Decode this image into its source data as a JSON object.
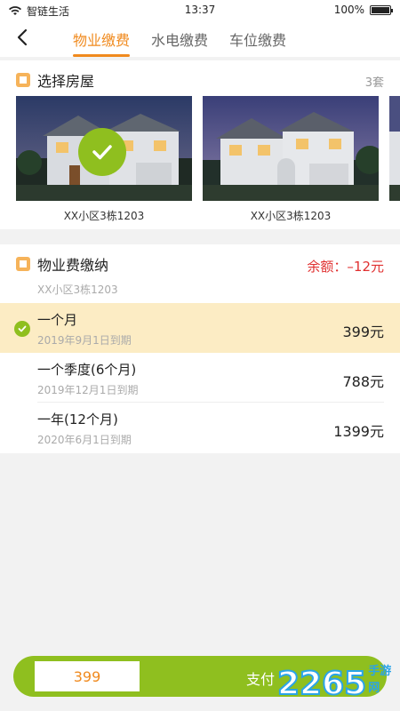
{
  "status_bar": {
    "carrier": "智链生活",
    "time": "13:37",
    "battery": "100%",
    "battery_level": 1.0
  },
  "header": {
    "tabs": [
      {
        "label": "物业缴费",
        "active": true
      },
      {
        "label": "水电缴费",
        "active": false
      },
      {
        "label": "车位缴费",
        "active": false
      }
    ]
  },
  "house_section": {
    "title": "选择房屋",
    "count": "3套",
    "houses": [
      {
        "label": "XX小区3栋1203",
        "selected": true
      },
      {
        "label": "XX小区3栋1203",
        "selected": false
      }
    ]
  },
  "fee_section": {
    "title": "物业费缴纳",
    "balance": "余额：–12元",
    "address": "XX小区3栋1203",
    "plans": [
      {
        "name": "一个月",
        "date": "2019年9月1日到期",
        "price": "399元",
        "selected": true
      },
      {
        "name": "一个季度(6个月)",
        "date": "2019年12月1日到期",
        "price": "788元",
        "selected": false
      },
      {
        "name": "一年(12个月)",
        "date": "2020年6月1日到期",
        "price": "1399元",
        "selected": false
      }
    ]
  },
  "pay_bar": {
    "amount": "399",
    "button": "支付"
  },
  "watermark": {
    "number": "2265",
    "text": "手游网"
  },
  "colors": {
    "accent": "#f08a1e",
    "green": "#8fbf1f",
    "balance_red": "#e03030",
    "selected_row": "#fcecc4",
    "watermark_blue": "#2aa4e8"
  }
}
